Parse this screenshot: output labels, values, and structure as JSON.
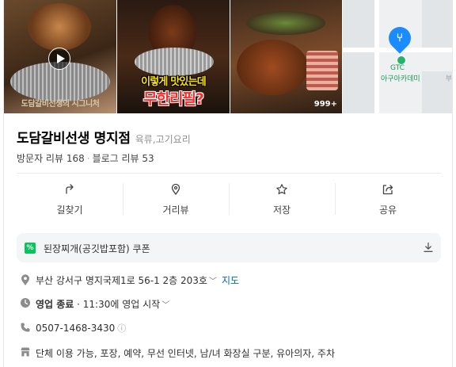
{
  "photos": {
    "photo1_caption": "도담갈비선생의 시그니처",
    "photo2_overlay_line1": "이렇게 맛있는데",
    "photo2_overlay_line2": "무한리필?",
    "photo3_count": "999+",
    "map": {
      "poi_line1": "GTC",
      "poi_line2": "아구아카데미",
      "edge_text": "부"
    }
  },
  "place": {
    "name": "도담갈비선생 명지점",
    "category": "육류,고기요리",
    "visitor_reviews": "방문자 리뷰 168",
    "blog_reviews": "블로그 리뷰 53"
  },
  "actions": [
    {
      "label": "길찾기",
      "icon": "directions-icon"
    },
    {
      "label": "거리뷰",
      "icon": "street-view-icon"
    },
    {
      "label": "저장",
      "icon": "star-icon"
    },
    {
      "label": "공유",
      "icon": "share-icon"
    }
  ],
  "coupon": {
    "badge": "%",
    "text": "된장찌개(공깃밥포함) 쿠폰"
  },
  "info": {
    "address": "부산 강서구 명지국제1로 56-1 2층 203호",
    "map_link": "지도",
    "hours_status": "영업 종료",
    "hours_detail": " · 11:30에 영업 시작",
    "phone": "0507-1468-3430",
    "phone_info_glyph": "ⓘ",
    "amenities": "단체 이용 가능, 포장, 예약, 무선 인터넷, 남/녀 화장실 구분, 유아의자, 주차"
  },
  "colors": {
    "accent_green": "#03c75a",
    "link_blue": "#0068c3",
    "pin_blue": "#1a8cff"
  }
}
